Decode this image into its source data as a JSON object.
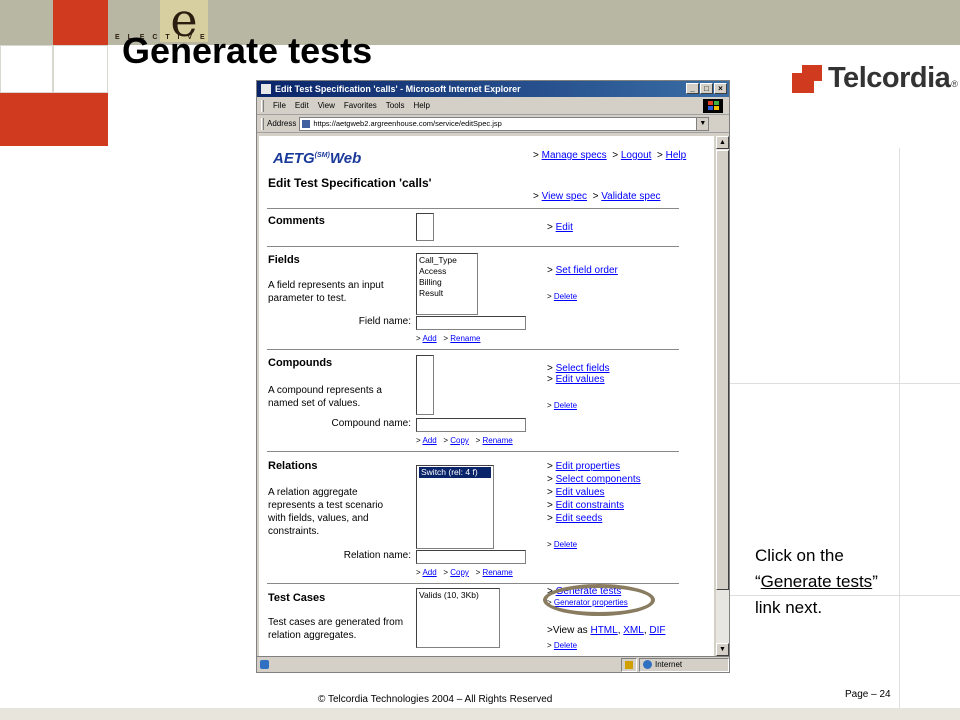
{
  "slide": {
    "title": "Generate tests",
    "logo_word": "E L E C T I V E",
    "logo_letter": "e",
    "brand": "Telcordia",
    "brand_mark": "®",
    "caption_line1": "Click on the",
    "caption_link": "Generate tests",
    "caption_open_quote": "“",
    "caption_close_quote": "”",
    "caption_line3": "link next.",
    "copyright": "© Telcordia Technologies 2004 – All Rights Reserved",
    "page": "Page – 24"
  },
  "browser": {
    "title": "Edit Test Specification 'calls' - Microsoft Internet Explorer",
    "menu": [
      "File",
      "Edit",
      "View",
      "Favorites",
      "Tools",
      "Help"
    ],
    "address_label": "Address",
    "address_value": "https://aetgweb2.argreenhouse.com/service/editSpec.jsp",
    "status_zone": "Internet",
    "btn_min": "_",
    "btn_max": "□",
    "btn_close": "×"
  },
  "page": {
    "logo": "AETG",
    "logo_sup": "(SM)",
    "logo_suffix": "Web",
    "heading": "Edit Test Specification 'calls'",
    "top_links": [
      "Manage specs",
      "Logout",
      "Help"
    ],
    "spec_links": [
      "View spec",
      "Validate spec"
    ],
    "comments": {
      "title": "Comments",
      "link": "Edit"
    },
    "fields": {
      "title": "Fields",
      "desc": "A field represents an input parameter to test.",
      "items": [
        "Call_Type",
        "Access",
        "Billing",
        "Result"
      ],
      "links": [
        "Set field order",
        "Delete"
      ],
      "name_label": "Field name:",
      "actions": [
        "Add",
        "Rename"
      ]
    },
    "compounds": {
      "title": "Compounds",
      "desc": "A compound represents a named set of values.",
      "links": [
        "Select fields",
        "Edit values",
        "Delete"
      ],
      "name_label": "Compound name:",
      "actions": [
        "Add",
        "Copy",
        "Rename"
      ]
    },
    "relations": {
      "title": "Relations",
      "desc": "A relation aggregate represents a test scenario with fields, values, and constraints.",
      "items": [
        "Switch (rel: 4 f)"
      ],
      "links": [
        "Edit properties",
        "Select components",
        "Edit values",
        "Edit constraints",
        "Edit seeds",
        "Delete"
      ],
      "name_label": "Relation name:",
      "actions": [
        "Add",
        "Copy",
        "Rename"
      ]
    },
    "test_cases": {
      "title": "Test Cases",
      "desc": "Test cases are generated from relation aggregates.",
      "items": [
        "Valids (10, 3Kb)"
      ],
      "links": [
        "Generate tests",
        "Generator properties"
      ],
      "view_as_label": ">View as",
      "view_as": [
        "HTML",
        "XML",
        "DIF"
      ],
      "delete": "Delete"
    }
  }
}
